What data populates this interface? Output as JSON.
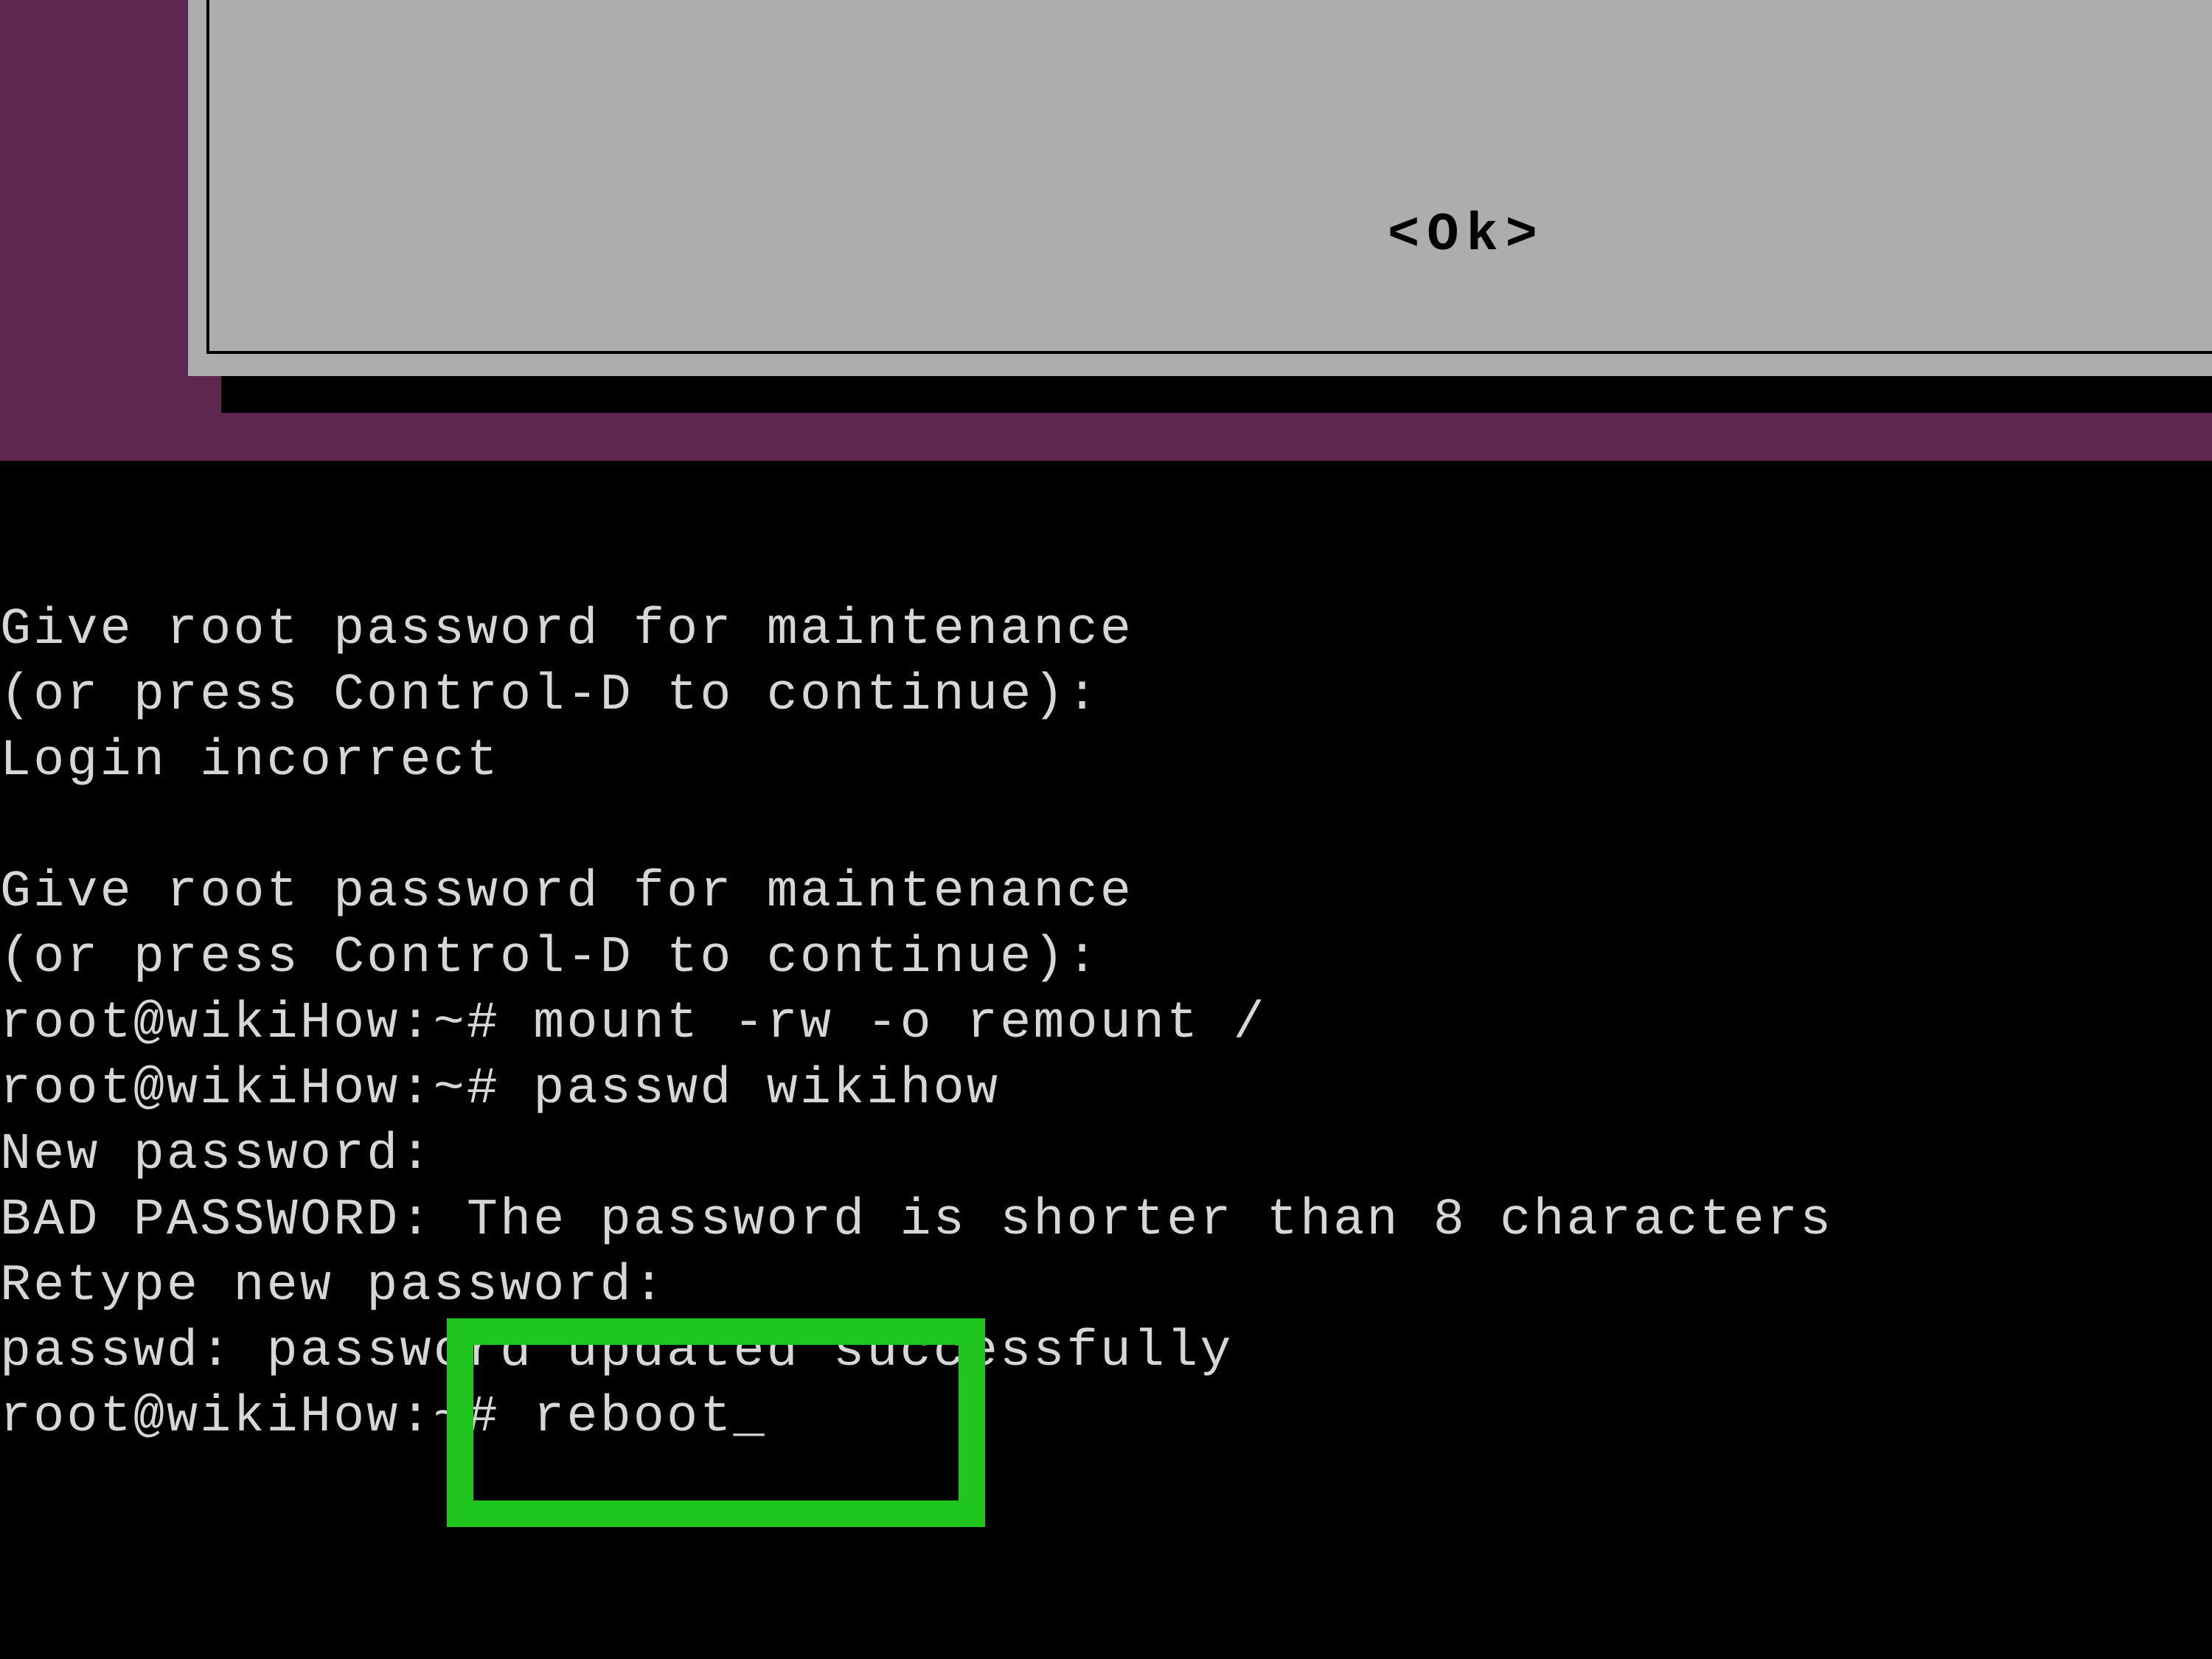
{
  "dialog": {
    "ok_label": "<Ok>"
  },
  "terminal": {
    "line01": "Give root password for maintenance",
    "line02": "(or press Control-D to continue):",
    "line03": "Login incorrect",
    "line04": "",
    "line05": "Give root password for maintenance",
    "line06": "(or press Control-D to continue):",
    "line07": "root@wikiHow:~# mount -rw -o remount /",
    "line08": "root@wikiHow:~# passwd wikihow",
    "line09": "New password:",
    "line10": "BAD PASSWORD: The password is shorter than 8 characters",
    "line11": "Retype new password:",
    "line12": "passwd: password updated successfully",
    "line13_prompt": "root@wikiHow:~# ",
    "line13_command": "reboot",
    "cursor": "_"
  },
  "highlight": {
    "description": "green annotation box around reboot command"
  }
}
